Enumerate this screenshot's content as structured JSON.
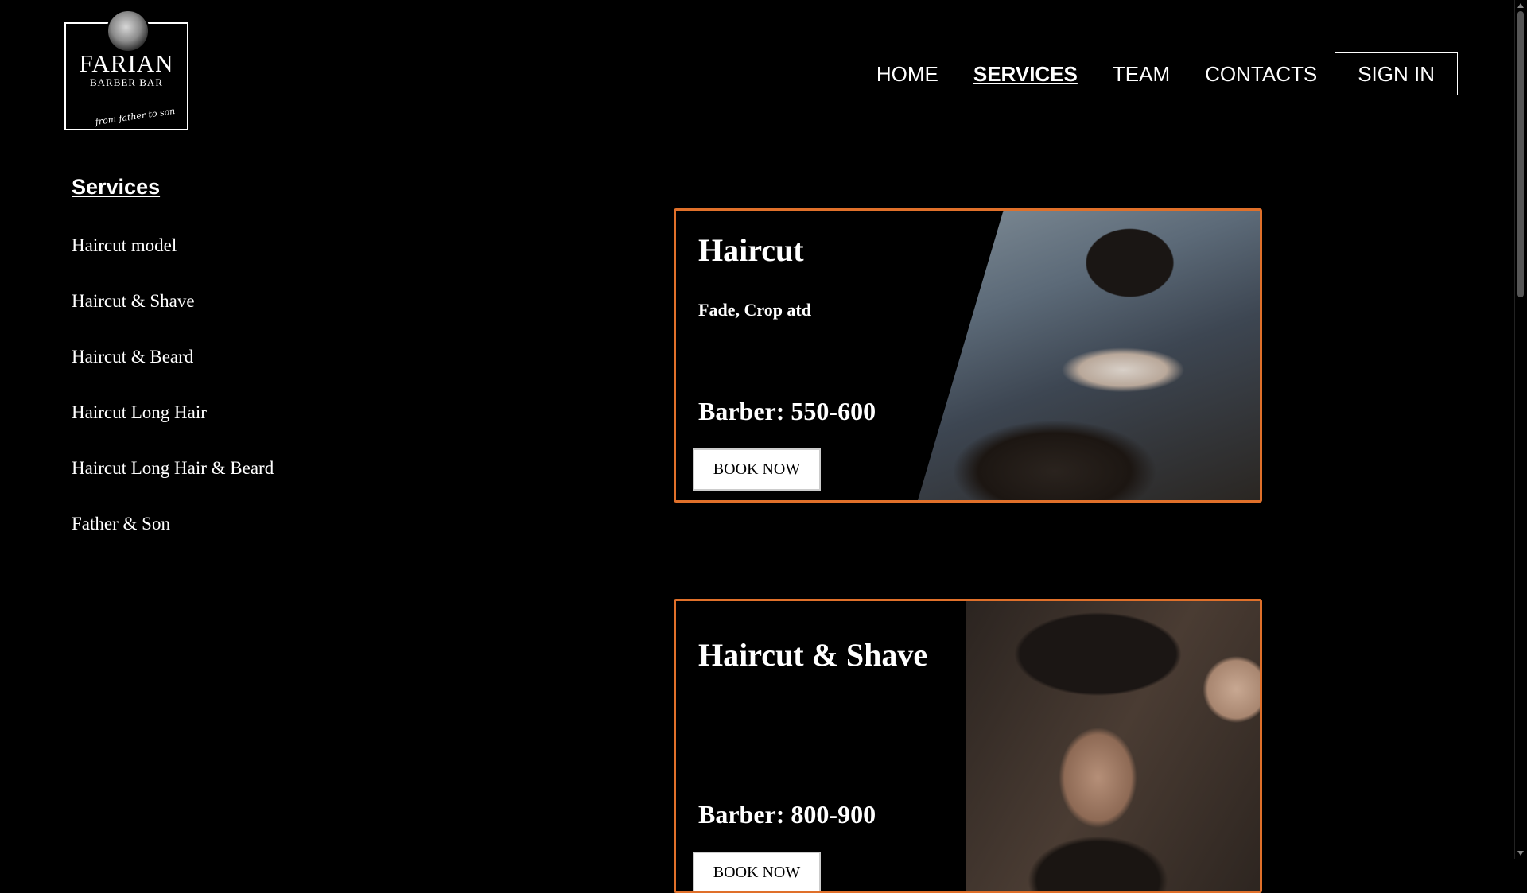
{
  "logo": {
    "name": "FARIAN",
    "subtitle": "BARBER BAR",
    "tagline": "from father to son"
  },
  "nav": {
    "items": [
      {
        "label": "HOME",
        "active": false
      },
      {
        "label": "SERVICES",
        "active": true
      },
      {
        "label": "TEAM",
        "active": false
      },
      {
        "label": "CONTACTS",
        "active": false
      }
    ],
    "signin_label": "SIGN IN"
  },
  "sidebar": {
    "title": "Services",
    "items": [
      {
        "label": "Haircut model"
      },
      {
        "label": "Haircut & Shave"
      },
      {
        "label": "Haircut & Beard"
      },
      {
        "label": "Haircut Long Hair"
      },
      {
        "label": "Haircut Long Hair & Beard"
      },
      {
        "label": "Father & Son"
      }
    ]
  },
  "cards": [
    {
      "title": "Haircut",
      "description": "Fade, Crop atd",
      "price": "Barber: 550-600",
      "button_label": "BOOK NOW"
    },
    {
      "title": "Haircut & Shave",
      "description": "",
      "price": "Barber: 800-900",
      "button_label": "BOOK NOW"
    }
  ],
  "colors": {
    "background": "#000000",
    "text": "#ffffff",
    "card_border": "#e0702a",
    "button_bg": "#ffffff"
  }
}
